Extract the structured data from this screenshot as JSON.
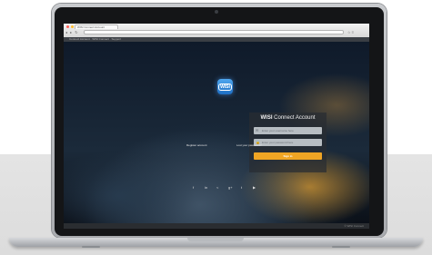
{
  "browser": {
    "tab_title": "WISI Connect Account",
    "nav_glyphs": "◂ ▸ ↻",
    "url": "",
    "tools_glyphs": "☆ ≡",
    "bookmarks_text": "Connect Account · WISI Connect · Support"
  },
  "app": {
    "logo_text": "WISI",
    "title_bold": "WISI",
    "title_rest": " Connect Account",
    "username_placeholder": "Enter your username here",
    "password_placeholder": "Enter your password here",
    "signin_label": "Sign in",
    "register_link": "Register account",
    "forgot_link": "Lost your password?",
    "social": [
      "f",
      "in",
      "<",
      "g+",
      "t",
      "▶"
    ],
    "footer_text": "© WISI Connect"
  },
  "colors": {
    "accent": "#f0a524",
    "logo_blue": "#2d86db"
  }
}
